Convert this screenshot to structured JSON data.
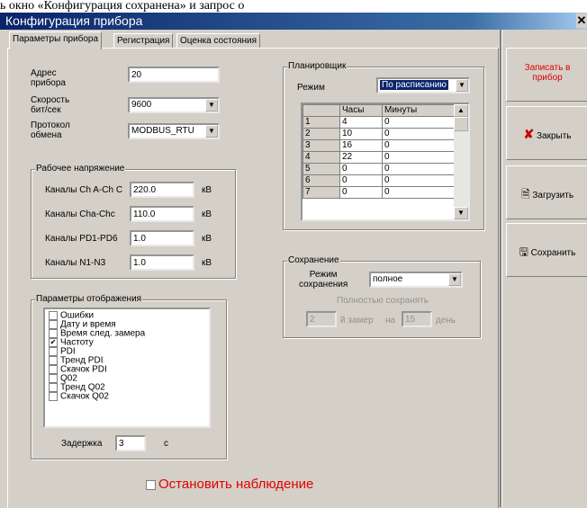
{
  "top_text": "ь окно «Конфигурация сохранена» и запрос о",
  "window": {
    "title": "Конфигурация прибора",
    "close_glyph": "✕"
  },
  "tabs": [
    "Параметры прибора",
    "Регистрация",
    "Оценка состояния"
  ],
  "device": {
    "address_label": "Адрес\nприбора",
    "address_value": "20",
    "speed_label": "Скорость\nбит/сек",
    "speed_value": "9600",
    "protocol_label": "Протокол\nобмена",
    "protocol_value": "MODBUS_RTU"
  },
  "voltage": {
    "title": "Рабочее напряжение",
    "rows": [
      {
        "label": "Каналы Ch A-Ch C",
        "value": "220.0",
        "unit": "кВ"
      },
      {
        "label": "Каналы Cha-Chc",
        "value": "110.0",
        "unit": "кВ"
      },
      {
        "label": "Каналы PD1-PD6",
        "value": "1.0",
        "unit": "кВ"
      },
      {
        "label": "Каналы N1-N3",
        "value": "1.0",
        "unit": "кВ"
      }
    ]
  },
  "display": {
    "title": "Параметры отображения",
    "items": [
      {
        "label": "Ошибки",
        "checked": false
      },
      {
        "label": "Дату и время",
        "checked": false
      },
      {
        "label": "Время след. замера",
        "checked": false
      },
      {
        "label": "Частоту",
        "checked": true
      },
      {
        "label": "PDI",
        "checked": false
      },
      {
        "label": "Тренд PDI",
        "checked": false
      },
      {
        "label": "Скачок PDI",
        "checked": false
      },
      {
        "label": "Q02",
        "checked": false
      },
      {
        "label": "Тренд Q02",
        "checked": false
      },
      {
        "label": "Скачок Q02",
        "checked": false
      }
    ],
    "delay_label": "Задержка",
    "delay_value": "3",
    "delay_unit": "с"
  },
  "stop_label": "Остановить наблюдение",
  "scheduler": {
    "title": "Планировщик",
    "mode_label": "Режим",
    "mode_value": "По расписанию",
    "headers": [
      "Часы",
      "Минуты"
    ],
    "rows": [
      [
        "1",
        "4",
        "0"
      ],
      [
        "2",
        "10",
        "0"
      ],
      [
        "3",
        "16",
        "0"
      ],
      [
        "4",
        "22",
        "0"
      ],
      [
        "5",
        "0",
        "0"
      ],
      [
        "6",
        "0",
        "0"
      ],
      [
        "7",
        "0",
        "0"
      ]
    ]
  },
  "saving": {
    "title": "Сохранение",
    "mode_label": "Режим\nсохранения",
    "mode_value": "полное",
    "full_save_label": "Полностью сохранять",
    "count_value": "2",
    "count_suffix": "й замер",
    "on_label": "на",
    "day_value": "15",
    "day_suffix": "день"
  },
  "buttons": {
    "write": "Записать в прибор",
    "close": "Закрыть",
    "load": "Загрузить",
    "save": "Сохранить"
  },
  "colors": {
    "write_text": "#e00000",
    "close_icon": "#cc0000",
    "stop_text": "#e00000"
  }
}
